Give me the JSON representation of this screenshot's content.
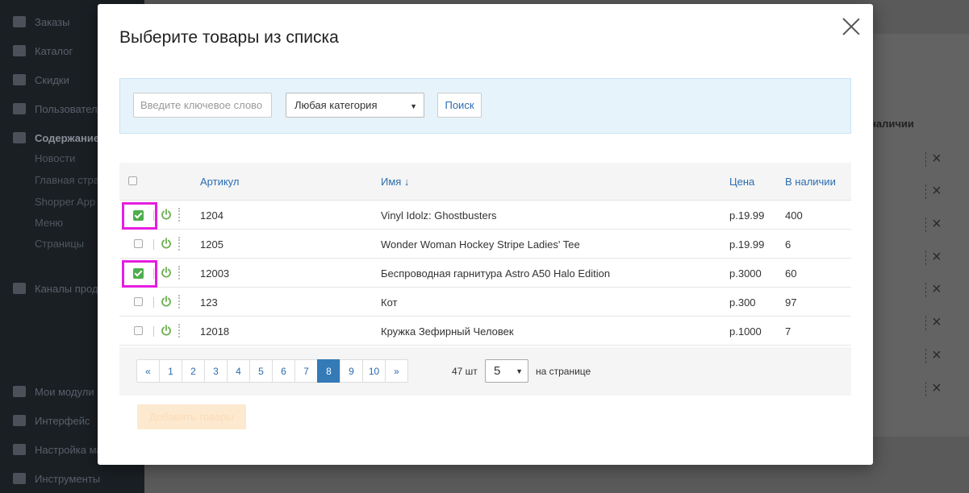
{
  "sidebar": {
    "items": [
      {
        "label": "Заказы",
        "icon": "cart-icon"
      },
      {
        "label": "Каталог",
        "icon": "tags-icon"
      },
      {
        "label": "Скидки",
        "icon": "gift-icon"
      },
      {
        "label": "Пользователи",
        "icon": "users-icon"
      },
      {
        "label": "Содержание",
        "icon": "newspaper-icon"
      }
    ],
    "content_sub": [
      "Новости",
      "Главная страница",
      "Shopper App",
      "Меню",
      "Страницы"
    ],
    "channels": {
      "label": "Каналы продаж",
      "icon": "asterisk-icon"
    },
    "bottom": [
      {
        "label": "Мои модули",
        "icon": "puzzle-icon"
      },
      {
        "label": "Интерфейс",
        "icon": "image-icon"
      },
      {
        "label": "Настройка магазина",
        "icon": "info-icon"
      },
      {
        "label": "Инструменты",
        "icon": "gear-icon"
      }
    ]
  },
  "background": {
    "column_header": "наличии",
    "row_delete_icon": "close-icon"
  },
  "modal": {
    "title": "Выберите товары из списка",
    "close_icon": "close-icon"
  },
  "filter": {
    "search_placeholder": "Введите ключевое слово",
    "category_value": "Любая категория",
    "search_button": "Поиск"
  },
  "table": {
    "headers": {
      "sku": "Артикул",
      "name": "Имя ↓",
      "price": "Цена",
      "stock": "В наличии"
    },
    "rows": [
      {
        "sku": "1204",
        "name": "Vinyl Idolz: Ghostbusters",
        "price": "р.19.99",
        "stock": "400",
        "checked": true
      },
      {
        "sku": "1205",
        "name": "Wonder Woman Hockey Stripe Ladies' Tee",
        "price": "р.19.99",
        "stock": "6",
        "checked": false
      },
      {
        "sku": "12003",
        "name": "Беспроводная гарнитура Astro A50 Halo Edition",
        "price": "р.3000",
        "stock": "60",
        "checked": true
      },
      {
        "sku": "123",
        "name": "Кот",
        "price": "р.300",
        "stock": "97",
        "checked": false
      },
      {
        "sku": "12018",
        "name": "Кружка Зефирный Человек",
        "price": "р.1000",
        "stock": "7",
        "checked": false
      }
    ]
  },
  "pagination": {
    "prev": "«",
    "pages": [
      "1",
      "2",
      "3",
      "4",
      "5",
      "6",
      "7",
      "8",
      "9",
      "10"
    ],
    "current": "8",
    "next": "»",
    "total": "47 шт",
    "per_page_value": "5",
    "per_page_label": "на странице"
  },
  "actions": {
    "add_button": "Добавить товары"
  },
  "colors": {
    "accent": "#337ab7",
    "link": "#2a6db0",
    "check_green": "#4cae4c",
    "highlight": "#e51ee0",
    "filter_bg": "#e6f3fb"
  }
}
